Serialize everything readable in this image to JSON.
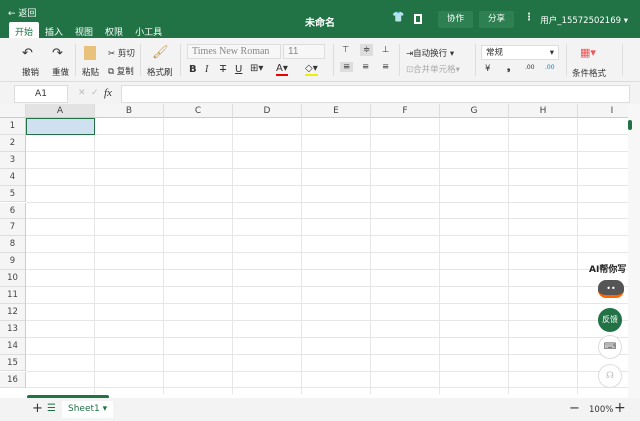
{
  "header": {
    "back": "← 返回",
    "title": "未命名",
    "collab": "协作",
    "share": "分享",
    "more": "⋮",
    "user": "用户_15572502169 ▾",
    "icons": [
      "shirt-icon",
      "panel-icon"
    ]
  },
  "tabs": [
    "开始",
    "插入",
    "视图",
    "权限",
    "小工具"
  ],
  "toolbar": {
    "undo": "撤销",
    "redo": "重做",
    "paste": "粘贴",
    "cut": "剪切",
    "copy": "复制",
    "format_painter": "格式刷",
    "font": "Times New Roman",
    "font_size": "11",
    "bold": "B",
    "italic": "I",
    "strike": "T",
    "underline": "U",
    "wrap": "自动换行",
    "merge": "合并单元格",
    "number_format": "常规",
    "currency": "¥",
    "percent": "%",
    "conditional": "条件格式"
  },
  "formula": {
    "cell": "A1",
    "fx": "fx",
    "value": ""
  },
  "columns": [
    "A",
    "B",
    "C",
    "D",
    "E",
    "F",
    "G",
    "H",
    "I"
  ],
  "rows": [
    "1",
    "2",
    "3",
    "4",
    "5",
    "6",
    "7",
    "8",
    "9",
    "10",
    "11",
    "12",
    "13",
    "14",
    "15",
    "16"
  ],
  "side": {
    "ai": "AI帮你写",
    "feedback": "反馈"
  },
  "bottom": {
    "sheet": "Sheet1",
    "zoom": "100%"
  },
  "colors": {
    "brand": "#217346"
  }
}
